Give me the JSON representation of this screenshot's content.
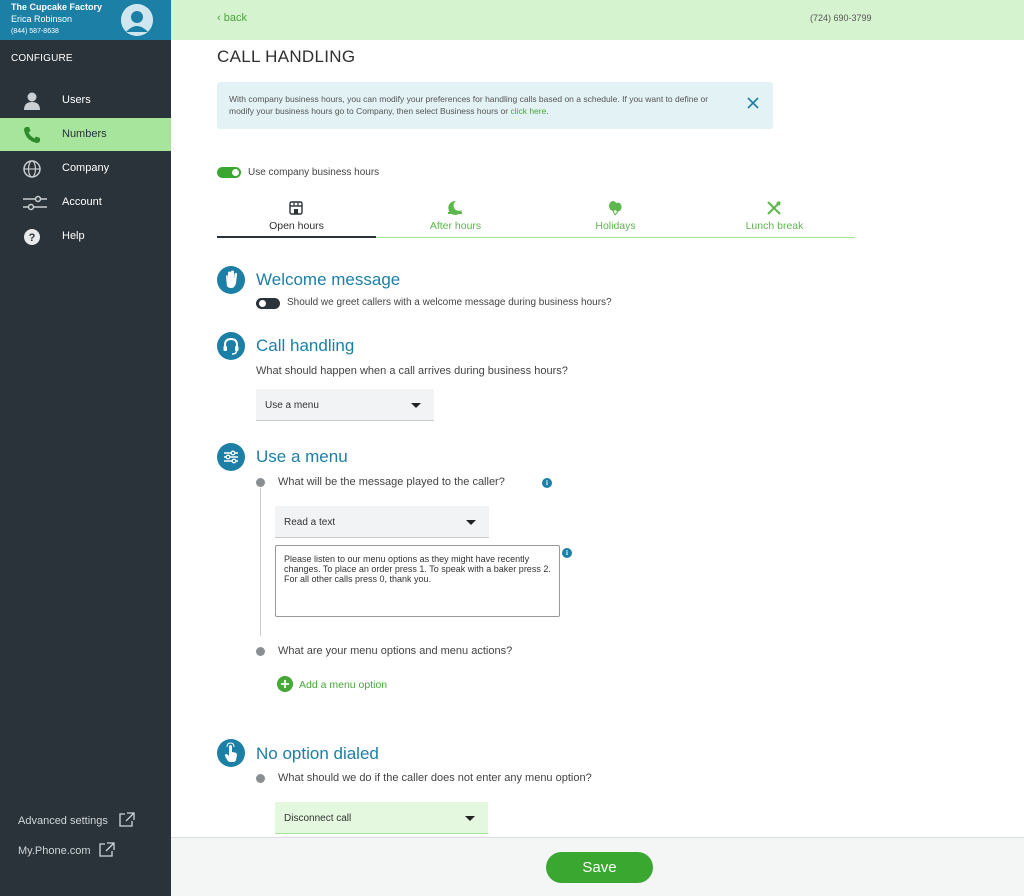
{
  "account": {
    "company": "The Cupcake Factory",
    "user": "Erica Robinson",
    "phone": "(844) 587-8638"
  },
  "sidebar": {
    "section_label": "CONFIGURE",
    "items": [
      {
        "label": "Users",
        "icon": "user-icon",
        "active": false
      },
      {
        "label": "Numbers",
        "icon": "phone-icon",
        "active": true
      },
      {
        "label": "Company",
        "icon": "globe-icon",
        "active": false
      },
      {
        "label": "Account",
        "icon": "sliders-icon",
        "active": false
      },
      {
        "label": "Help",
        "icon": "help-icon",
        "active": false
      }
    ],
    "bottom_links": [
      {
        "label": "Advanced settings",
        "icon": "external-link-icon"
      },
      {
        "label": "My.Phone.com",
        "icon": "external-link-icon"
      }
    ]
  },
  "topbar": {
    "back_label": "back",
    "phone_number": "(724) 690-3799"
  },
  "page": {
    "title": "CALL HANDLING",
    "info_text": "With company business hours, you can modify your preferences for handling calls based on a schedule. If you want to define or modify your business hours go to Company, then select Business hours or ",
    "info_link": "click here",
    "info_end": ".",
    "business_hours_toggle": {
      "label": "Use company business hours",
      "on": true
    }
  },
  "tabs": [
    {
      "label": "Open hours",
      "icon": "storefront-icon",
      "active": true
    },
    {
      "label": "After hours",
      "icon": "moon-icon",
      "active": false
    },
    {
      "label": "Holidays",
      "icon": "balloons-icon",
      "active": false
    },
    {
      "label": "Lunch break",
      "icon": "utensils-icon",
      "active": false
    }
  ],
  "welcome": {
    "title": "Welcome message",
    "toggle_label": "Should we greet callers with a welcome message during business hours?",
    "toggle_on": false
  },
  "call_handling": {
    "title": "Call handling",
    "question": "What should happen when a call arrives during business hours?",
    "selected": "Use a menu"
  },
  "use_menu": {
    "title": "Use a menu",
    "q1": "What will be the message played to the caller?",
    "message_type": "Read a text",
    "message_text": "Please listen to our menu options as they might have recently changes. To place an order press 1. To speak with a baker press 2. For all other calls press 0, thank you.",
    "q2": "What are your menu options and menu actions?",
    "add_option_label": "Add a menu option"
  },
  "no_option": {
    "title": "No option dialed",
    "question": "What should we do if the caller does not enter any menu option?",
    "selected": "Disconnect call"
  },
  "footer": {
    "save_label": "Save"
  },
  "colors": {
    "sidebar_bg": "#2a3339",
    "account_bg": "#1c7fa6",
    "accent_green": "#48a838",
    "light_green": "#a7e49c",
    "section_blue": "#1c7fa6"
  }
}
